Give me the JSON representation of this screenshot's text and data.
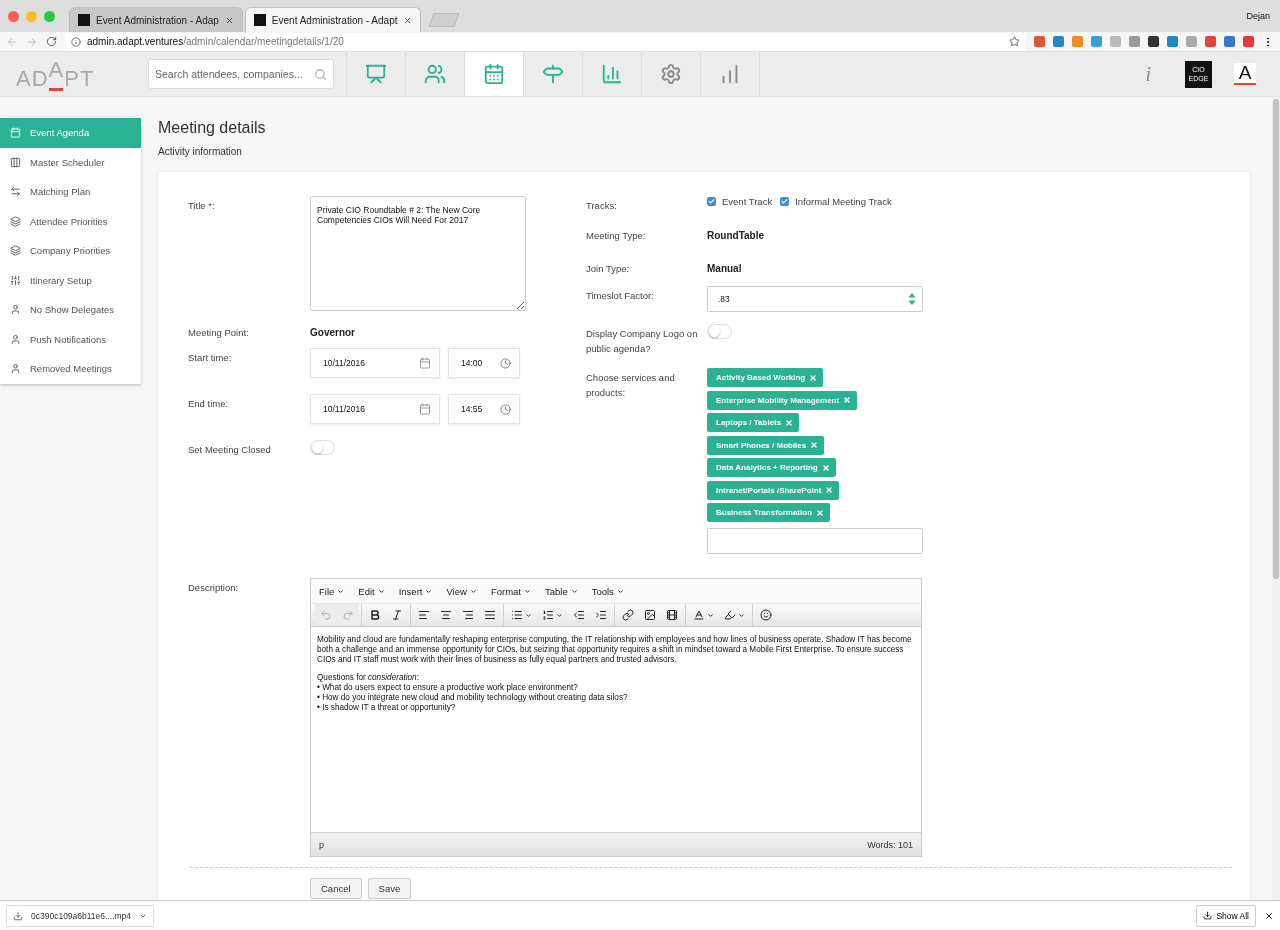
{
  "browser": {
    "tabs": [
      {
        "title": "Event Administration - Adap",
        "selected": false
      },
      {
        "title": "Event Administration - Adapt",
        "selected": true
      }
    ],
    "user": "Dejan",
    "address": {
      "host": "admin.adapt.ventures",
      "path": "/admin/calendar/meetingdetails/1/20"
    }
  },
  "header": {
    "logo": "ADAPT",
    "search": {
      "placeholder": "Search attendees, companies..."
    },
    "nav": [
      {
        "kind": "presentation",
        "selected": false
      },
      {
        "kind": "people",
        "selected": false
      },
      {
        "kind": "calendar",
        "selected": true
      },
      {
        "kind": "signpost",
        "selected": false
      },
      {
        "kind": "chart",
        "selected": false
      },
      {
        "kind": "settings",
        "selected": false
      },
      {
        "kind": "stats",
        "selected": false
      }
    ],
    "info": "i",
    "cio_logo": "CIO EDGE",
    "account_logo": "A"
  },
  "sidebar": {
    "items": [
      {
        "label": "Event Agenda",
        "kind": "calendar",
        "selected": true
      },
      {
        "label": "Master Scheduler",
        "kind": "columns",
        "selected": false
      },
      {
        "label": "Matching Plan",
        "kind": "swap",
        "selected": false
      },
      {
        "label": "Attendee Priorities",
        "kind": "stack",
        "selected": false
      },
      {
        "label": "Company Priorities",
        "kind": "stack",
        "selected": false
      },
      {
        "label": "Itinerary Setup",
        "kind": "sliders",
        "selected": false
      },
      {
        "label": "No Show Delegates",
        "kind": "person",
        "selected": false
      },
      {
        "label": "Push Notifications",
        "kind": "person",
        "selected": false
      },
      {
        "label": "Removed Meetings",
        "kind": "person",
        "selected": false
      }
    ]
  },
  "page": {
    "title": "Meeting details",
    "subtitle": "Activity information"
  },
  "form": {
    "title": {
      "label": "Title *:",
      "value": "Private CIO Roundtable # 2: The New Core Competencies CIOs Will Need For 2017"
    },
    "meeting_point": {
      "label": "Meeting Point:",
      "value": "Governor"
    },
    "start": {
      "label": "Start time:",
      "date": "10/11/2016",
      "time": "14:00"
    },
    "end": {
      "label": "End time:",
      "date": "10/11/2016",
      "time": "14:55"
    },
    "closed": {
      "label": "Set Meeting Closed",
      "on": false
    },
    "tracks": {
      "label": "Tracks:",
      "options": [
        {
          "label": "Event Track",
          "checked": true
        },
        {
          "label": "Informal Meeting Track",
          "checked": true
        }
      ]
    },
    "meeting_type": {
      "label": "Meeting Type:",
      "value": "RoundTable"
    },
    "join_type": {
      "label": "Join Type:",
      "value": "Manual"
    },
    "timeslot": {
      "label": "Timeslot Factor:",
      "value": ".83"
    },
    "logo": {
      "label": "Display Company Logo on public agenda?",
      "on": false
    },
    "services": {
      "label": "Choose services and products:",
      "tags": [
        "Activity Based Working",
        "Enterprise Mobility Management",
        "Laptops / Tablets",
        "Smart Phones / Mobiles",
        "Data Analytics + Reporting",
        "Intranet/Portals /SharePoint",
        "Business Transformation"
      ]
    },
    "description": {
      "label": "Description:",
      "menus": [
        "File",
        "Edit",
        "Insert",
        "View",
        "Format",
        "Table",
        "Tools"
      ],
      "toolbar": [
        {
          "kind": "undo",
          "disabled": true
        },
        {
          "kind": "redo",
          "disabled": true
        },
        {
          "kind": "bold",
          "disabled": false
        },
        {
          "kind": "italic",
          "disabled": false
        },
        {
          "kind": "align-left",
          "disabled": false
        },
        {
          "kind": "align-center",
          "disabled": false
        },
        {
          "kind": "align-right",
          "disabled": false
        },
        {
          "kind": "justify",
          "disabled": false
        },
        {
          "kind": "bullets",
          "disabled": false
        },
        {
          "kind": "numbers",
          "disabled": false
        },
        {
          "kind": "outdent",
          "disabled": false
        },
        {
          "kind": "indent",
          "disabled": false
        },
        {
          "kind": "link",
          "disabled": false
        },
        {
          "kind": "image",
          "disabled": false
        },
        {
          "kind": "media",
          "disabled": false
        },
        {
          "kind": "text-color",
          "disabled": false
        },
        {
          "kind": "back-color",
          "disabled": false
        },
        {
          "kind": "emoji",
          "disabled": false
        }
      ],
      "paragraph": "Mobility and cloud are fundamentally reshaping enterprise computing, the IT relationship with employees and how lines of business operate. Shadow IT has become both a challenge and an immense opportunity for CIOs, but seizing that opportunity requires a shift in mindset toward a Mobile First Enterprise. To ensure success CIOs and IT staff must work with their lines of business as fully equal partners and trusted advisors.",
      "lines": [
        "Questions for *consideration*:",
        "• What do users expect to ensure a productive work place environment?",
        "• How do you integrate new cloud and mobility technology without creating data silos?",
        "• Is shadow IT a threat or opportunity?"
      ],
      "path": "p",
      "words": "Words: 101"
    },
    "buttons": [
      "Cancel",
      "Save"
    ]
  },
  "downloads": {
    "file": "0c390c109a6b11e6....mp4",
    "show_all": "Show All"
  }
}
